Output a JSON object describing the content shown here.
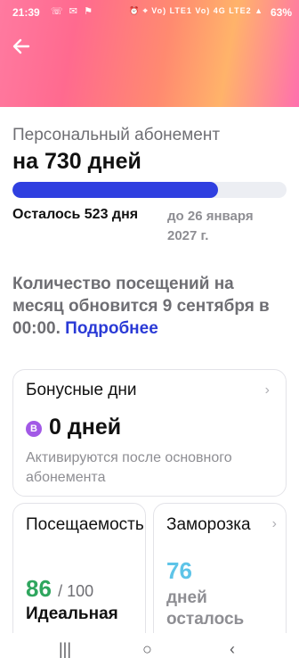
{
  "status_bar": {
    "time": "21:39",
    "left_icons": "☏ ✉ ⚑",
    "right_icons": "⏰ ⌖ Vo) LTE1 Vo) 4G LTE2 ▲",
    "battery": "63%"
  },
  "header": {
    "back_icon": "arrow-left-icon"
  },
  "subscription": {
    "label": "Персональный абонемент",
    "title": "на 730 дней",
    "progress_fraction": 0.75,
    "remaining": "Осталось 523 дня",
    "until": "до 26 января 2027 г.",
    "visits_info": "Количество посещений на месяц обновится 9 сентября в 00:00.",
    "more_link": "Подробнее"
  },
  "bonus_card": {
    "title": "Бонусные дни",
    "badge": "B",
    "days": "0 дней",
    "note": "Активируются после основного абонемента"
  },
  "attendance_card": {
    "title": "Посещаемость",
    "count": "86",
    "max": "/ 100",
    "label": "Идеальная"
  },
  "freeze_card": {
    "title": "Заморозка",
    "count": "76",
    "label": "дней осталось"
  },
  "nav": {
    "recent": "|||",
    "home": "○",
    "back": "‹"
  },
  "colors": {
    "progress": "#2f3fe0",
    "link": "#2a3ad6",
    "attendance": "#2fa65e",
    "freeze": "#5ec4e8",
    "badge": "#a259e6"
  }
}
